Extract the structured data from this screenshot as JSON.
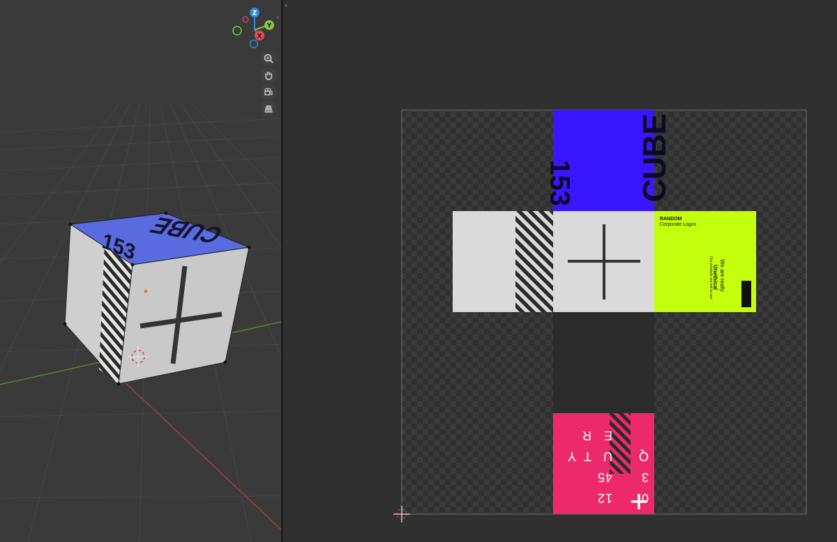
{
  "viewport": {
    "gizmo": {
      "z": "Z",
      "y": "Y",
      "x": "X",
      "colors": {
        "x": "#e34b5c",
        "y": "#8bc43f",
        "z": "#2e8be0"
      }
    },
    "nav_tools": [
      "zoom-icon",
      "pan-hand-icon",
      "camera-view-icon",
      "perspective-grid-icon"
    ],
    "cube": {
      "top_text_main": "CUBE",
      "top_text_num": "153"
    }
  },
  "uv_editor": {
    "blue_face": {
      "main": "CUBE",
      "num": "153",
      "color": "#3a16ff"
    },
    "green_face": {
      "brand": "RANDOM",
      "sub": "Corporate Logos",
      "line1": "We are really",
      "line2": "Unethical",
      "line3": "Our products are evil to use",
      "color": "#c4ff0e"
    },
    "pink_face": {
      "row1": [
        "Q",
        "U",
        "T"
      ],
      "row2": [
        "3",
        "E",
        "Y"
      ],
      "row3": [
        "45",
        "R",
        ""
      ],
      "row4": [
        "0",
        "12",
        ""
      ],
      "color": "#ec2a6b"
    }
  },
  "colors": {
    "viewport_bg": "#3a3a3a",
    "editor_bg": "#303030",
    "grey_face": "#dadada",
    "dark_face": "#2b2b2b"
  }
}
